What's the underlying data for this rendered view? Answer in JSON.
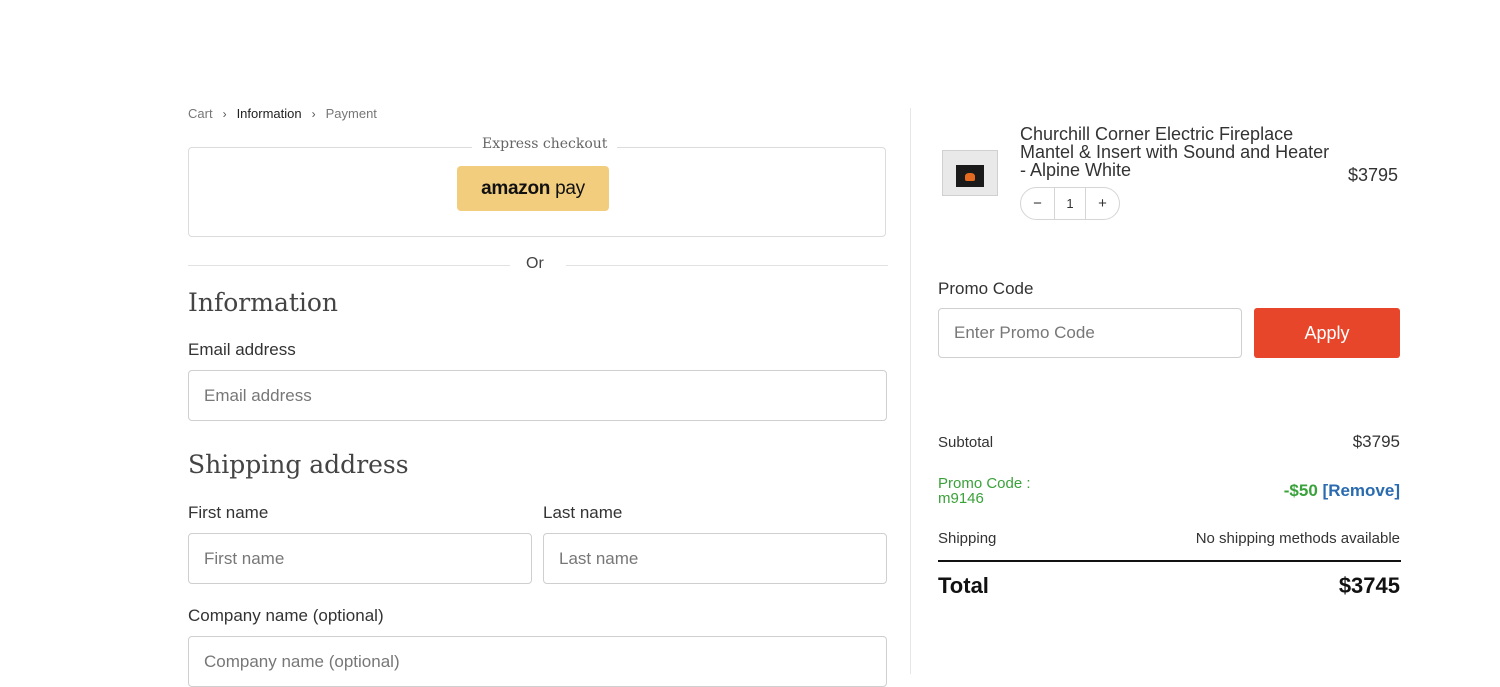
{
  "breadcrumb": {
    "cart": "Cart",
    "information": "Information",
    "payment": "Payment",
    "separator": "›"
  },
  "express": {
    "label": "Express checkout",
    "amazon_brand": "amazon",
    "amazon_pay": "pay"
  },
  "or_text": "Or",
  "information": {
    "title": "Information",
    "email_label": "Email address",
    "email_placeholder": "Email address"
  },
  "shipping": {
    "title": "Shipping address",
    "first_name_label": "First name",
    "first_name_placeholder": "First name",
    "last_name_label": "Last name",
    "last_name_placeholder": "Last name",
    "company_label": "Company name (optional)",
    "company_placeholder": "Company name (optional)"
  },
  "product": {
    "name": "Churchill Corner Electric Fireplace Mantel & Insert with Sound and Heater - Alpine White",
    "price": "$3795",
    "quantity": "1",
    "minus": "−",
    "plus": "+"
  },
  "promo": {
    "label": "Promo Code",
    "placeholder": "Enter Promo Code",
    "apply": "Apply"
  },
  "summary": {
    "subtotal_label": "Subtotal",
    "subtotal_value": "$3795",
    "promo_applied_label": "Promo Code :",
    "promo_applied_code": "m9146",
    "promo_discount": "-$50",
    "promo_remove": "[Remove]",
    "shipping_label": "Shipping",
    "shipping_value": "No shipping methods available",
    "total_label": "Total",
    "total_value": "$3745"
  },
  "colors": {
    "accent": "#e8462a",
    "amazon": "#f3cd7e",
    "promo_green": "#3aa23a",
    "link_blue": "#2a6bb0"
  }
}
